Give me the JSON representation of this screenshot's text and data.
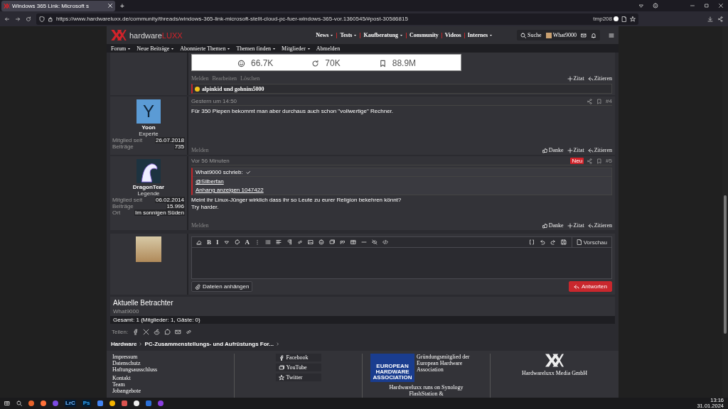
{
  "browser": {
    "tab_title": "Windows 365 Link: Microsoft s",
    "new_tab": "+",
    "url": "https://www.hardwareluxx.de/community/threads/windows-365-link-microsoft-stellt-cloud-pc-fuer-windows-365-vor.1360545/#post-30586815",
    "profile": "tmp208"
  },
  "site": {
    "logo_main": "hardware",
    "logo_accent": "LUXX",
    "nav": [
      {
        "label": "News",
        "dropdown": true
      },
      {
        "label": "Tests",
        "dropdown": true
      },
      {
        "label": "Kaufberatung",
        "dropdown": true
      },
      {
        "label": "Community",
        "dropdown": false
      },
      {
        "label": "Videos",
        "dropdown": false
      },
      {
        "label": "Internes",
        "dropdown": true
      }
    ],
    "search": "Suche",
    "user": "What9000",
    "subnav": [
      {
        "label": "Forum",
        "dropdown": true
      },
      {
        "label": "Neue Beiträge",
        "dropdown": true
      },
      {
        "label": "Abonnierte Themen",
        "dropdown": true
      },
      {
        "label": "Themen finden",
        "dropdown": true
      },
      {
        "label": "Mitglieder",
        "dropdown": true
      },
      {
        "label": "Abmelden",
        "dropdown": false
      }
    ]
  },
  "posts": [
    {
      "kind": "continuation",
      "embed_stats": [
        "66.7K",
        "70K",
        "88.9M"
      ],
      "actions_left": [
        "Melden",
        "Bearbeiten",
        "Löschen"
      ],
      "actions_right": [
        "Zitat",
        "Zitieren"
      ],
      "reactions": "alpinkid und gohnim5000"
    },
    {
      "kind": "full",
      "avatar": {
        "kind": "letter",
        "letter": "Y"
      },
      "author": "Yoon",
      "rank": "Experte",
      "stats": [
        {
          "label": "Mitglied seit",
          "value": "26.07.2018"
        },
        {
          "label": "Beiträge",
          "value": "735"
        }
      ],
      "time": "Gestern um 14:50",
      "number": "#4",
      "body": [
        "Für 350 Piepen bekommt man aber durchaus auch schon \"vollwertige\" Rechner."
      ],
      "actions_left": [
        "Melden"
      ],
      "actions_right": [
        "Danke",
        "Zitat",
        "Zitieren"
      ]
    },
    {
      "kind": "full",
      "avatar": {
        "kind": "image"
      },
      "author": "DragonTear",
      "rank": "Legende",
      "stats": [
        {
          "label": "Mitglied seit",
          "value": "06.02.2014"
        },
        {
          "label": "Beiträge",
          "value": "15.996"
        },
        {
          "label": "Ort",
          "value": "Im sonnigen Süden"
        }
      ],
      "time": "Vor 56 Minuten",
      "badge": "Neu",
      "number": "#5",
      "quote": {
        "author": "What9000 schrieb:",
        "lines": [
          "@Silberfan",
          "Anhang anzeigen 1047422"
        ]
      },
      "body": [
        "Meint ihr Linux-Jünger wirklich dass ihr so Leute zu eurer Religion bekehren könnt?",
        "Try harder."
      ],
      "actions_left": [
        "Melden"
      ],
      "actions_right": [
        "Danke",
        "Zitat",
        "Zitieren"
      ]
    }
  ],
  "editor": {
    "toolbar_glyphs": [
      "B",
      "I",
      "A"
    ],
    "preview": "Vorschau",
    "attach": "Dateien anhängen",
    "submit": "Antworten"
  },
  "viewers": {
    "title": "Aktuelle Betrachter",
    "members": [
      "What9000"
    ],
    "total": "Gesamt: 1 (Mitglieder: 1, Gäste: 0)"
  },
  "share": {
    "label": "Teilen:"
  },
  "breadcrumb": [
    "Hardware",
    "PC-Zusammenstellungs- und Aufrüstungs For..."
  ],
  "footer": {
    "link_groups": [
      [
        "Impressum",
        "Datenschutz",
        "Haftungsausschluss"
      ],
      [
        "Kontakt",
        "Team",
        "Jobangebote"
      ]
    ],
    "social": [
      "Facebook",
      "YouTube",
      "Twitter"
    ],
    "eha_logo": "EUROPEAN HARDWARE ASSOCIATION",
    "eha_text": "Gründungsmitglied der European Hardware Association",
    "runs_on": "Hardwareluxx runs on Synology FlashStation &",
    "company": "Hardwareluxx Media GmbH"
  },
  "taskbar": {
    "apps": [
      "LrC",
      "Ps"
    ],
    "time": "13:16",
    "date": "31.01.2024"
  }
}
